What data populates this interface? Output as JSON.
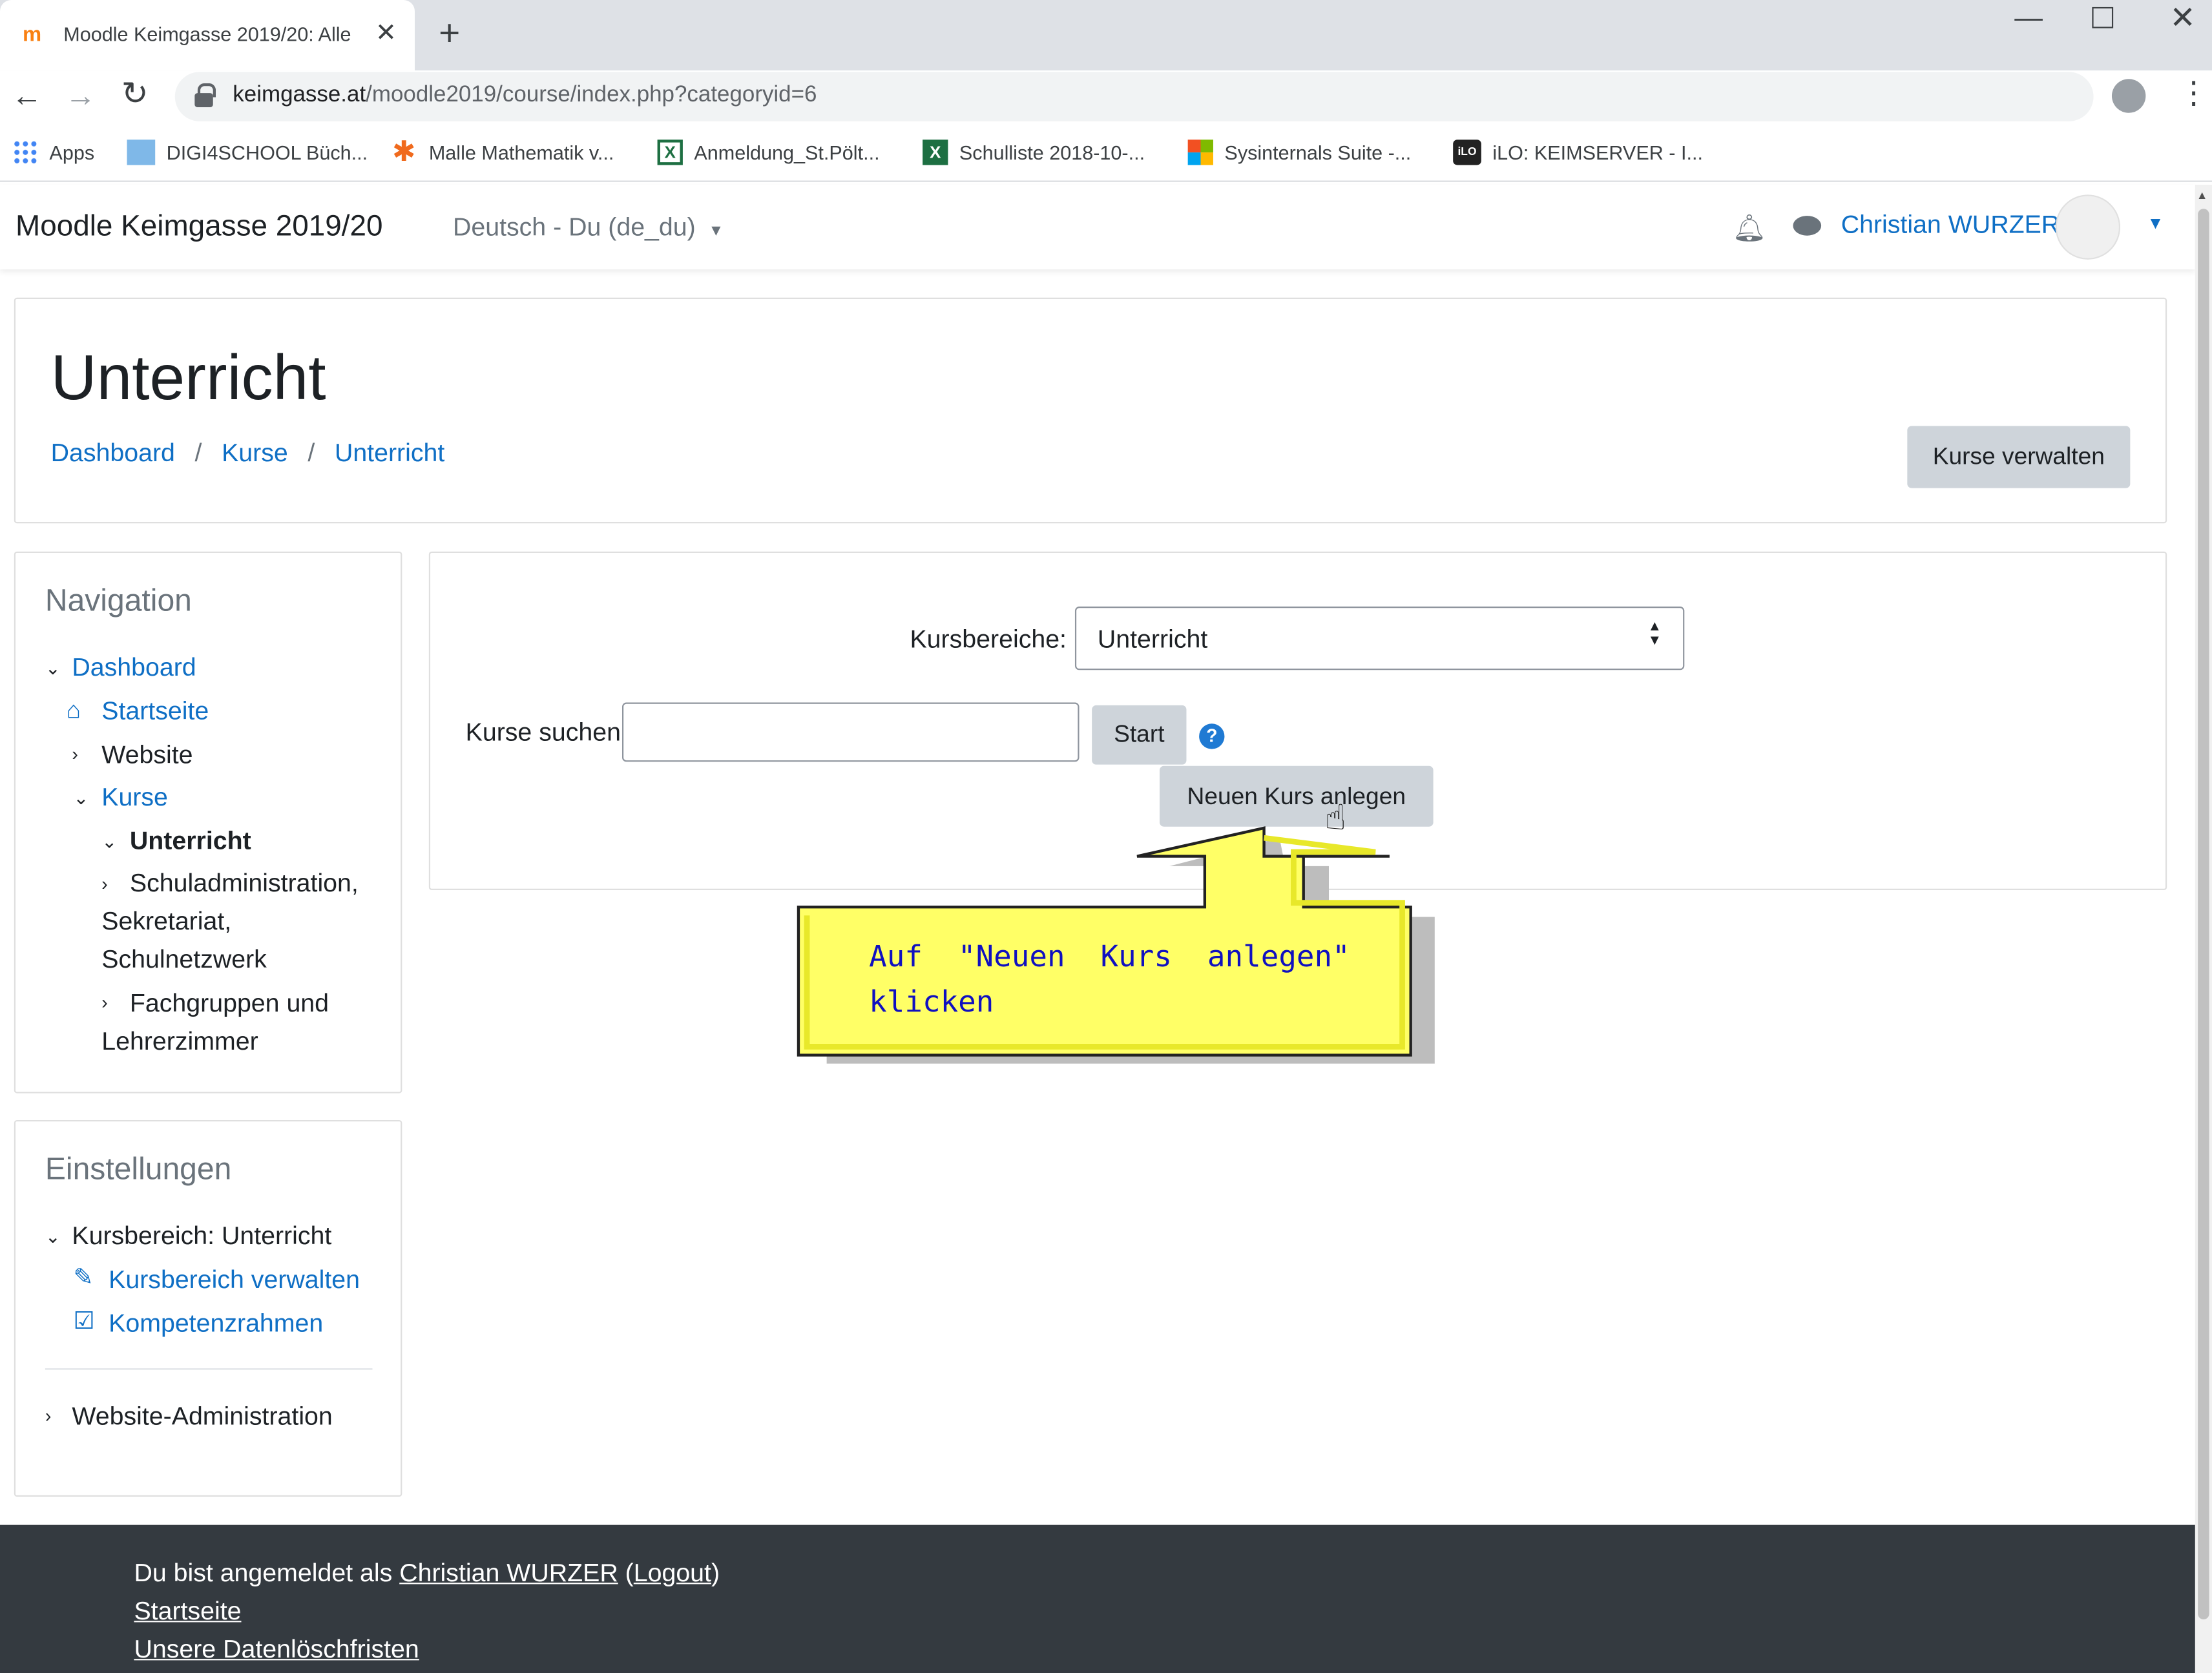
{
  "browser": {
    "tab_title": "Moodle Keimgasse 2019/20: Alle",
    "url_host": "keimgasse.at",
    "url_path": "/moodle2019/course/index.php?categoryid=6",
    "bookmarks": [
      "Apps",
      "DIGI4SCHOOL Büch...",
      "Malle Mathematik v...",
      "Anmeldung_St.Pölt...",
      "Schulliste 2018-10-...",
      "Sysinternals Suite -...",
      "iLO: KEIMSERVER - I..."
    ]
  },
  "navbar": {
    "site_name": "Moodle Keimgasse 2019/20",
    "language": "Deutsch - Du (de_du)",
    "user_name": "Christian WURZER"
  },
  "header": {
    "title": "Unterricht",
    "breadcrumb": [
      "Dashboard",
      "Kurse",
      "Unterricht"
    ],
    "manage_button": "Kurse verwalten"
  },
  "navigation_block": {
    "title": "Navigation",
    "dashboard": "Dashboard",
    "startseite": "Startseite",
    "website": "Website",
    "kurse": "Kurse",
    "unterricht": "Unterricht",
    "schuladmin": [
      "Schuladministration,",
      "Sekretariat,",
      "Schulnetzwerk"
    ],
    "fachgruppen": [
      "Fachgruppen und",
      "Lehrerzimmer"
    ]
  },
  "settings_block": {
    "title": "Einstellungen",
    "kursbereich": "Kursbereich: Unterricht",
    "verwalten": "Kursbereich verwalten",
    "kompetenz": "Kompetenzrahmen",
    "website_admin": "Website-Administration"
  },
  "main": {
    "category_label": "Kursbereiche:",
    "category_value": "Unterricht",
    "search_label": "Kurse suchen",
    "search_value": "",
    "start_button": "Start",
    "new_course_button": "Neuen Kurs anlegen"
  },
  "callout": {
    "line1": [
      "Auf",
      "\"Neuen",
      "Kurs",
      "anlegen\""
    ],
    "line2": "klicken"
  },
  "footer": {
    "logged_in_prefix": "Du bist angemeldet als ",
    "user": "Christian WURZER",
    "logout": "Logout",
    "startseite": "Startseite",
    "datenloesch": "Unsere Datenlöschfristen"
  },
  "colors": {
    "link": "#0f6fc5",
    "callout_fill": "#ffff66",
    "footer_bg": "#343a40"
  }
}
